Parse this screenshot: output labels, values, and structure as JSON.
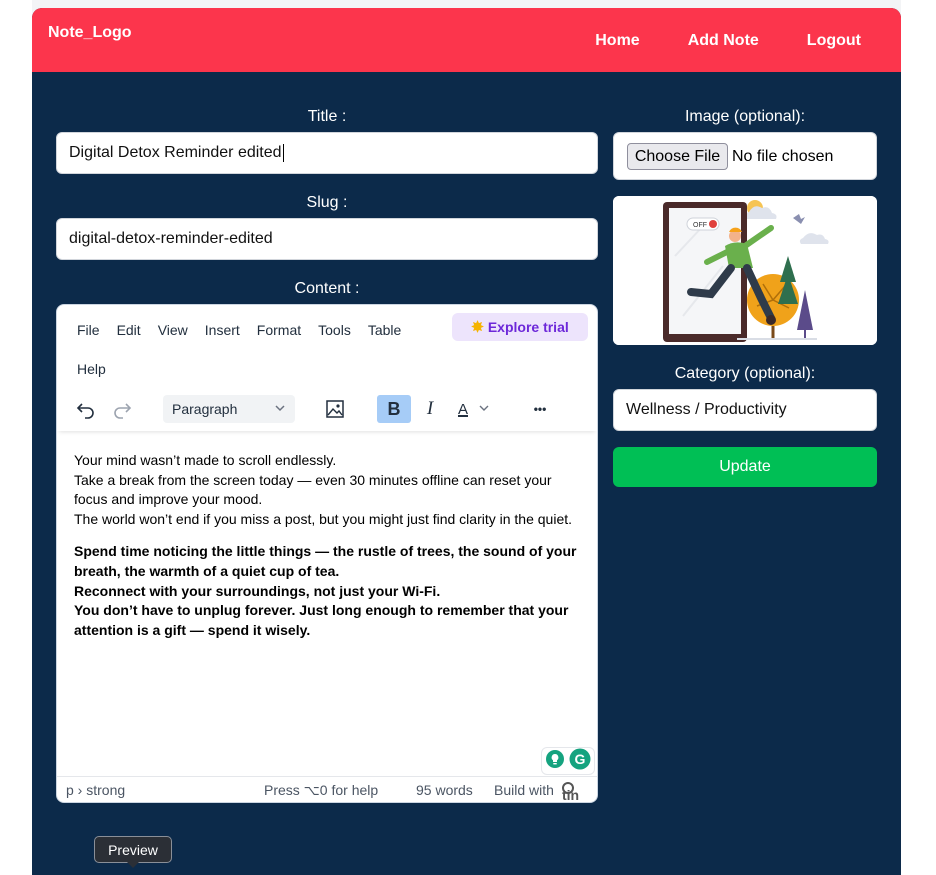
{
  "nav": {
    "logo": "Note_Logo",
    "links": [
      "Home",
      "Add Note",
      "Logout"
    ]
  },
  "form": {
    "title_label": "Title :",
    "title_value": "Digital Detox Reminder edited",
    "slug_label": "Slug :",
    "slug_value": "digital-detox-reminder-edited",
    "content_label": "Content :",
    "image_label": "Image (optional):",
    "choose_file": "Choose File",
    "no_file": "No file chosen",
    "category_label": "Category (optional):",
    "category_value": "Wellness / Productivity",
    "update_label": "Update"
  },
  "editor": {
    "menu": [
      "File",
      "Edit",
      "View",
      "Insert",
      "Format",
      "Tools",
      "Table"
    ],
    "menu_help": "Help",
    "explore_trial": "Explore trial",
    "block_format": "Paragraph",
    "bold_label": "B",
    "italic_label": "I",
    "text_color_label": "A",
    "more_label": "•••",
    "paragraph1": [
      "Your mind wasn’t made to scroll endlessly.",
      "Take a break from the screen today — even 30 minutes offline can reset your focus and improve your mood.",
      "The world won’t end if you miss a post, but you might just find clarity in the quiet."
    ],
    "paragraph2": [
      "Spend time noticing the little things — the rustle of trees, the sound of your breath, the warmth of a quiet cup of tea.",
      "Reconnect with your surroundings, not just your Wi-Fi.",
      "You don’t have to unplug forever. Just long enough to remember that your attention is a gift — spend it wisely."
    ],
    "status_path": "p › strong",
    "status_help": "Press ⌥0 for help",
    "word_count": "95 words",
    "build_with": "Build with",
    "brand_partial": "tin"
  },
  "illustration": {
    "switch_label": "OFF"
  },
  "tooltip": {
    "text": "Preview"
  },
  "colors": {
    "navbar": "#fc354c",
    "background": "#0c2a4a",
    "update_button": "#00bf55",
    "explore_trial": "#6d28d9"
  }
}
